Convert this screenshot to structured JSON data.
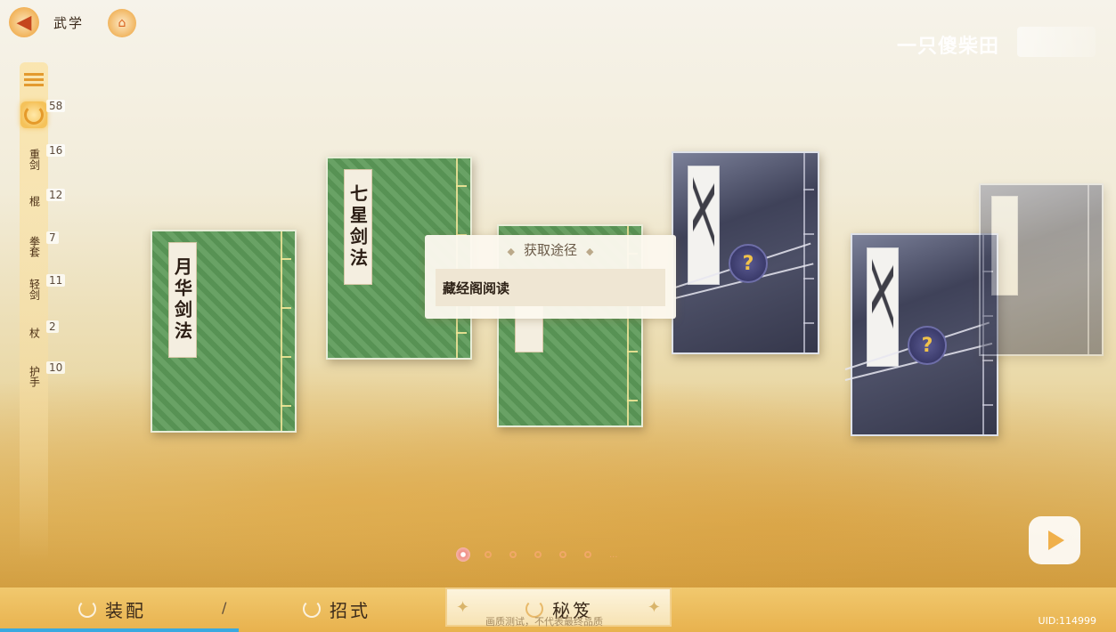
{
  "header": {
    "back_icon": "back-arrow-icon",
    "title": "武学",
    "home_icon": "home-icon"
  },
  "watermark": {
    "text": "一只傻柴田"
  },
  "sidebar": {
    "items": [
      {
        "icon": "list-icon",
        "label": "",
        "count": ""
      },
      {
        "icon": "all-categories-icon",
        "label": "",
        "count": "58"
      },
      {
        "icon": "",
        "label": "重剑",
        "count": "16"
      },
      {
        "icon": "",
        "label": "棍",
        "count": "12"
      },
      {
        "icon": "",
        "label": "拳套",
        "count": "7"
      },
      {
        "icon": "",
        "label": "轻剑",
        "count": "11"
      },
      {
        "icon": "",
        "label": "杖",
        "count": "2"
      },
      {
        "icon": "",
        "label": "护手",
        "count": "10"
      }
    ]
  },
  "books": [
    {
      "title": "月华剑法",
      "style": "green"
    },
    {
      "title": "七星剑法",
      "style": "green"
    },
    {
      "title": "",
      "style": "green"
    },
    {
      "title": "",
      "style": "dark-locked",
      "icon": "question-mark-icon"
    },
    {
      "title": "",
      "style": "dark-locked",
      "icon": "question-mark-icon"
    },
    {
      "title": "",
      "style": "dark-faded"
    }
  ],
  "popup": {
    "title": "获取途径",
    "source": "藏经阁阅读"
  },
  "pagination": {
    "total_dots": 6,
    "active_index": 0,
    "more": "..."
  },
  "bottom_tabs": [
    {
      "label": "装配",
      "icon": "gear-ring-icon"
    },
    {
      "label": "招式",
      "icon": "gear-ring-icon"
    },
    {
      "label": "秘笈",
      "icon": "gear-ring-icon",
      "active": true
    }
  ],
  "divider": "/",
  "note": "画质测试，不代表最终品质",
  "uid": "UID:114999",
  "colors": {
    "accent": "#e39a2e",
    "green_book": "#5c9a58",
    "dark_book": "#3f4259",
    "progress": "#3aa9e0"
  }
}
